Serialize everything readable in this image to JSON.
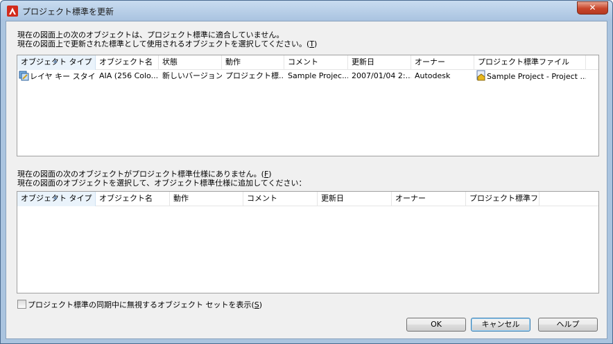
{
  "window": {
    "title": "プロジェクト標準を更新",
    "close_symbol": "✕",
    "app_icon": "autocad-icon"
  },
  "section1": {
    "line1": "現在の図面上の次のオブジェクトは、プロジェクト標準に適合していません。",
    "line2_pre": "現在の図面上で更新された標準として使用されるオブジェクトを選択してください。(",
    "line2_key": "T",
    "line2_post": ")"
  },
  "list1": {
    "columns": [
      "オブジェクト タイプ",
      "オブジェクト名",
      "状態",
      "動作",
      "コメント",
      "更新日",
      "オーナー",
      "プロジェクト標準ファイル"
    ],
    "rows": [
      {
        "icon": "layer-key-style-icon",
        "file_icon": "standards-file-icon",
        "cells": [
          "レイヤ キー スタイ...",
          "AIA (256 Colo...",
          "新しいバージョン",
          "プロジェクト標...",
          "Sample Projec...",
          "2007/01/04 2:...",
          "Autodesk",
          "Sample Project - Project ..."
        ]
      }
    ]
  },
  "section2": {
    "line1_pre": "現在の図面の次のオブジェクトがプロジェクト標準仕様にありません。(",
    "line1_key": "F",
    "line1_post": ")",
    "line2": "現在の図面のオブジェクトを選択して、オブジェクト標準仕様に追加してください："
  },
  "list2": {
    "columns": [
      "オブジェクト タイプ",
      "オブジェクト名",
      "動作",
      "コメント",
      "更新日",
      "オーナー",
      "プロジェクト標準フ..."
    ]
  },
  "checkbox": {
    "label_pre": "プロジェクト標準の同期中に無視するオブジェクト セットを表示(",
    "label_key": "S",
    "label_post": ")",
    "checked": false
  },
  "buttons": {
    "ok": "OK",
    "cancel": "キャンセル",
    "help": "ヘルプ"
  }
}
